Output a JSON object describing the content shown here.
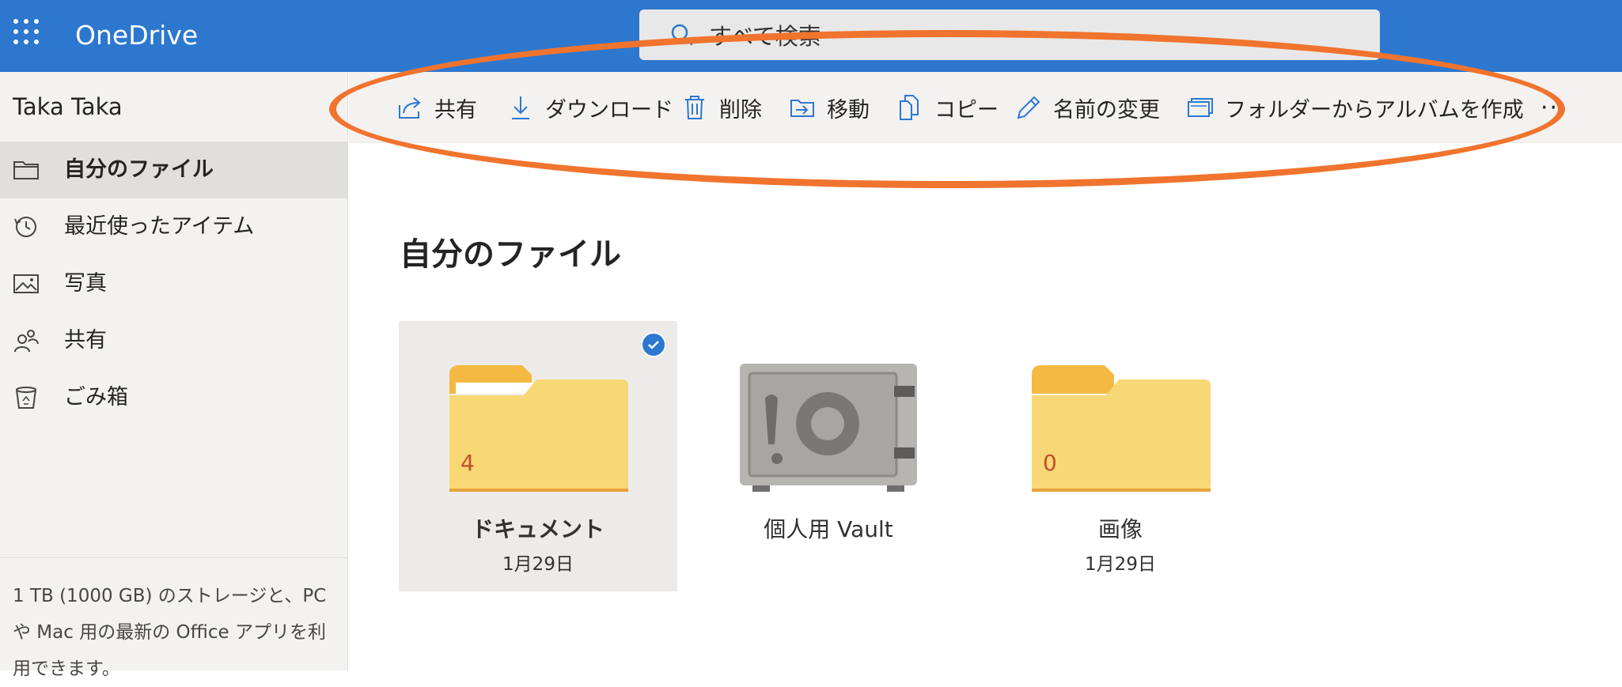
{
  "app": {
    "name": "OneDrive"
  },
  "header": {
    "search_placeholder": "すべて検索",
    "icons": [
      "app-launcher-icon",
      "search-icon"
    ]
  },
  "sidebar": {
    "user_name": "Taka Taka",
    "items": [
      {
        "label": "自分のファイル",
        "icon": "folder-icon",
        "active": true
      },
      {
        "label": "最近使ったアイテム",
        "icon": "history-icon",
        "active": false
      },
      {
        "label": "写真",
        "icon": "photo-icon",
        "active": false
      },
      {
        "label": "共有",
        "icon": "people-icon",
        "active": false
      },
      {
        "label": "ごみ箱",
        "icon": "recycle-bin-icon",
        "active": false
      }
    ],
    "promo_lines": [
      "1 TB (1000 GB) のストレージと、PC",
      "や Mac 用の最新の Office アプリを利",
      "用できます。"
    ]
  },
  "commandbar": {
    "items": [
      {
        "label": "共有",
        "icon": "share-icon"
      },
      {
        "label": "ダウンロード",
        "icon": "download-icon"
      },
      {
        "label": "削除",
        "icon": "delete-icon"
      },
      {
        "label": "移動",
        "icon": "move-icon"
      },
      {
        "label": "コピー",
        "icon": "copy-icon"
      },
      {
        "label": "名前の変更",
        "icon": "rename-icon"
      },
      {
        "label": "フォルダーからアルバムを作成",
        "icon": "album-icon"
      }
    ],
    "more_label": "···"
  },
  "main": {
    "title": "自分のファイル",
    "tiles": [
      {
        "name": "ドキュメント",
        "date": "1月29日",
        "count": "4",
        "type": "folder",
        "selected": true
      },
      {
        "name": "個人用 Vault",
        "date": "",
        "count": "",
        "type": "vault",
        "selected": false
      },
      {
        "name": "画像",
        "date": "1月29日",
        "count": "0",
        "type": "folder",
        "selected": false
      }
    ]
  },
  "colors": {
    "brand_blue": "#2d77cf",
    "annotation_orange": "#f0742e",
    "folder_yellow": "#f8d775"
  }
}
